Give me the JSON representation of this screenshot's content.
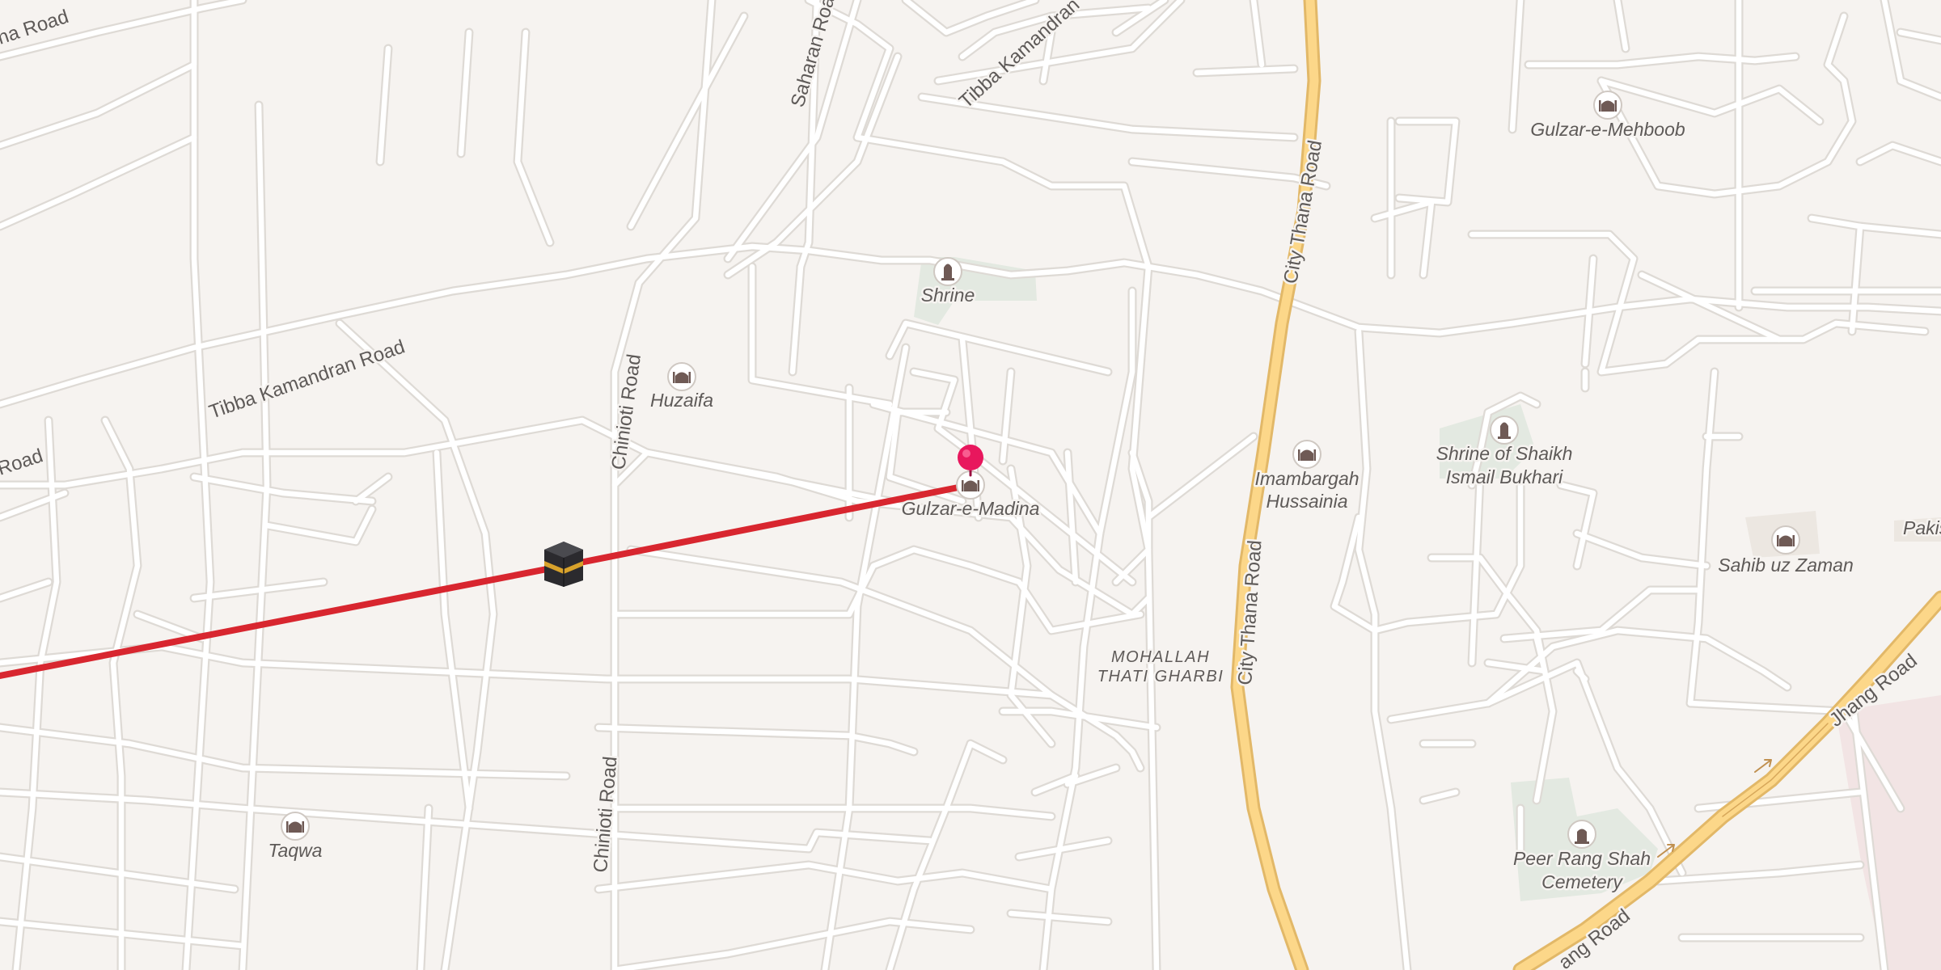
{
  "map": {
    "colors": {
      "background": "#f6f3f0",
      "street": "#ffffff",
      "street_casing": "#dedad5",
      "primary_road": "#fcd789",
      "primary_casing": "#e2b868",
      "green_area": "#e3e9e1",
      "route_line": "#d8262f",
      "destination_pin": "#e8175d",
      "poi_icon": "#6f5a55"
    },
    "road_labels": {
      "tibba_kamandran_1": "Tibba Kamandran Road",
      "tibba_kamandran_2": "Tibba Kamandran",
      "city_thana_1": "City Thana Road",
      "city_thana_2": "City Thana Road",
      "chinioti_1": "Chinioti Road",
      "chinioti_2": "Chinioti Road",
      "saharan": "Saharan Road",
      "jhang_1": "Jhang Road",
      "jhang_2": "ang Road",
      "left_top": "na Road",
      "left_mid": "Road"
    },
    "area_label": {
      "line1": "MOHALLAH",
      "line2": "THATI GHARBI"
    },
    "pois": {
      "shrine": {
        "name": "Shrine",
        "icon": "shrine-icon"
      },
      "huzaifa": {
        "name": "Huzaifa",
        "icon": "mosque-icon"
      },
      "gulzar_madina": {
        "name": "Gulzar-e-Madina",
        "icon": "mosque-icon"
      },
      "gulzar_mehboob": {
        "name": "Gulzar-e-Mehboob",
        "icon": "mosque-icon"
      },
      "imambargah_1": "Imambargah",
      "imambargah_2": "Hussainia",
      "shaikh_1": "Shrine of Shaikh",
      "shaikh_2": "Ismail Bukhari",
      "sahib_uz_zaman": "Sahib uz Zaman",
      "pakis": "Pakis",
      "taqwa": "Taqwa",
      "peer_1": "Peer Rang Shah",
      "peer_2": "Cemetery"
    },
    "markers": {
      "kaaba": "kaaba-icon",
      "destination": "map-pin-icon"
    }
  }
}
